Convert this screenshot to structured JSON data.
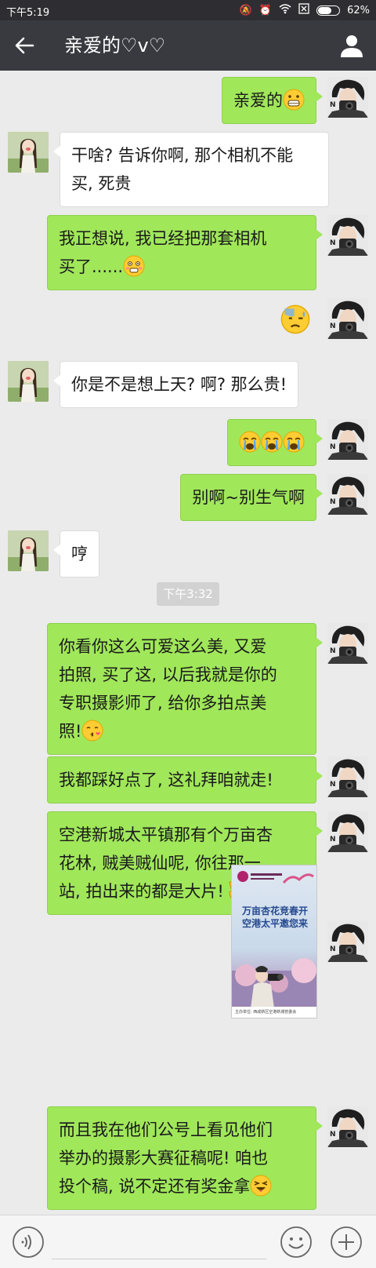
{
  "status_bar": {
    "time": "下午5:19",
    "battery": "62%",
    "battery_level": 0.62
  },
  "header": {
    "back_icon": "arrow-left-icon",
    "title": "亲爱的♡v♡",
    "profile_icon": "person-icon"
  },
  "messages": [
    {
      "from": "me",
      "text": "亲爱的",
      "emoji": "grin-face"
    },
    {
      "from": "her",
      "lines": [
        "干啥? 告诉你啊, 那个相机不能",
        "买, 死贵"
      ]
    },
    {
      "from": "me",
      "lines": [
        "我正想说, 我已经把那套相机",
        "买了......"
      ],
      "emoji": "embarrassed-face"
    },
    {
      "from": "me",
      "type": "sticker",
      "emoji": "cold-sweat-face"
    },
    {
      "from": "her",
      "text": "你是不是想上天? 啊? 那么贵!"
    },
    {
      "from": "me",
      "type": "emoji_only",
      "emoji": "crying-face"
    },
    {
      "from": "me",
      "text": "别啊~别生气啊"
    },
    {
      "from": "her",
      "text": "哼"
    },
    {
      "from": "me",
      "lines": [
        "你看你这么可爱这么美, 又爱",
        "拍照, 买了这, 以后我就是你的",
        "专职摄影师了, 给你多拍点美",
        "照!"
      ],
      "emoji": "kiss-face"
    },
    {
      "from": "me",
      "text": "我都踩好点了, 这礼拜咱就走!"
    },
    {
      "from": "me",
      "lines": [
        "空港新城太平镇那有个万亩杏",
        "花林, 贼美贼仙呢, 你往那一",
        "站, 拍出来的都是大片!"
      ],
      "emoji": "victory-hand"
    },
    {
      "from": "me",
      "type": "image"
    },
    {
      "from": "me",
      "lines": [
        "而且我在他们公号上看见他们",
        "举办的摄影大赛征稿呢! 咱也",
        "投个稿, 说不定还有奖金拿"
      ],
      "emoji": "squint-face"
    }
  ],
  "timestamp": "下午3:32",
  "poster": {
    "headline": "万亩杏花竞春开 空港太平邀您来",
    "footer": "主办单位: 西咸新区空港新城管委会"
  },
  "bottom_bar": {
    "voice_icon": "voice-icon",
    "emoji_icon": "smile-icon",
    "more_icon": "plus-icon"
  },
  "colors": {
    "outgoing_bubble": "#a0e75a",
    "incoming_bubble": "#ffffff",
    "header_bg": "#393a3f",
    "chat_bg": "#ebebeb"
  }
}
